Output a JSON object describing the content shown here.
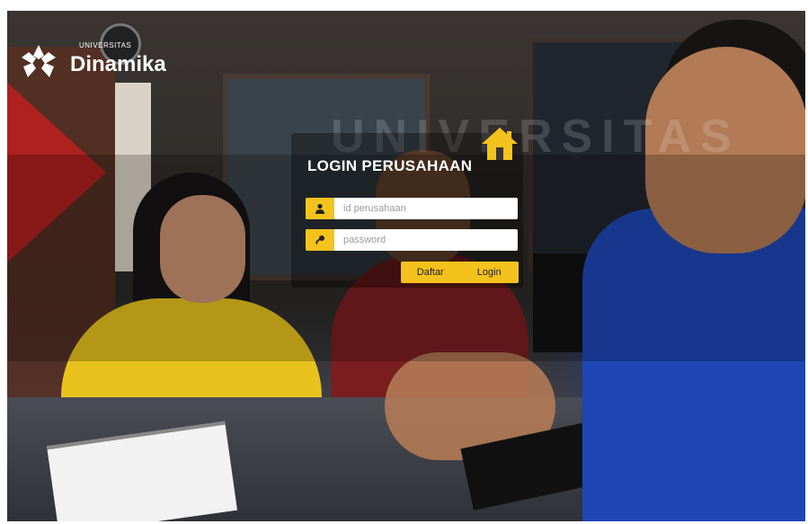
{
  "brand": {
    "university_small": "UNIVERSITAS",
    "name": "Dinamika",
    "watermark": "UNIVERSITAS"
  },
  "login": {
    "title": "LOGIN PERUSAHAAN",
    "id_placeholder": "id perusahaan",
    "password_placeholder": "password",
    "register_label": "Daftar",
    "login_label": "Login",
    "home_icon": "home-icon",
    "user_icon": "user-icon",
    "key_icon": "key-icon"
  },
  "colors": {
    "accent": "#f4c21c",
    "brand_red": "#c01f1f"
  }
}
